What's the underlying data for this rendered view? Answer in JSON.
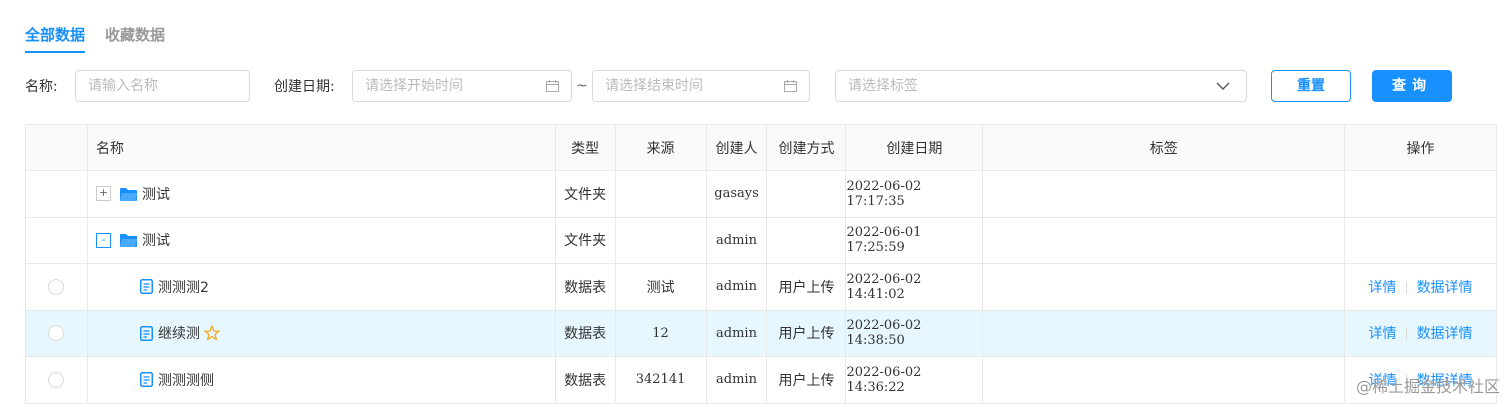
{
  "tabs": [
    {
      "label": "全部数据",
      "active": true
    },
    {
      "label": "收藏数据",
      "active": false
    }
  ],
  "filters": {
    "name_label": "名称:",
    "name_placeholder": "请输入名称",
    "date_label": "创建日期:",
    "start_placeholder": "请选择开始时间",
    "end_placeholder": "请选择结束时间",
    "range_separator": "~",
    "tag_placeholder": "请选择标签",
    "reset_label": "重置",
    "query_label": "查询"
  },
  "table": {
    "headers": [
      "名称",
      "类型",
      "来源",
      "创建人",
      "创建方式",
      "创建日期",
      "标签",
      "操作"
    ],
    "rows": [
      {
        "kind": "folder",
        "expander": "+",
        "name": "测试",
        "type": "文件夹",
        "source": "",
        "creator": "gasays",
        "method": "",
        "date": "2022-06-02 17:17:35",
        "tag": ""
      },
      {
        "kind": "folder",
        "expander": "-",
        "name": "测试",
        "type": "文件夹",
        "source": "",
        "creator": "admin",
        "method": "",
        "date": "2022-06-01 17:25:59",
        "tag": ""
      },
      {
        "kind": "file",
        "name": "测测测2",
        "type": "数据表",
        "source": "测试",
        "creator": "admin",
        "method": "用户上传",
        "date": "2022-06-02 14:41:02",
        "tag": "",
        "actions": [
          "详情",
          "数据详情"
        ]
      },
      {
        "kind": "file",
        "name": "继续测",
        "starred": true,
        "type": "数据表",
        "source": "12",
        "creator": "admin",
        "method": "用户上传",
        "date": "2022-06-02 14:38:50",
        "tag": "",
        "actions": [
          "详情",
          "数据详情"
        ],
        "highlight": true
      },
      {
        "kind": "file",
        "name": "测测测侧",
        "type": "数据表",
        "source": "342141",
        "creator": "admin",
        "method": "用户上传",
        "date": "2022-06-02 14:36:22",
        "tag": "",
        "actions": [
          "详情",
          "数据详情"
        ]
      }
    ]
  },
  "watermark": "@稀土掘金技术社区",
  "colors": {
    "accent": "#1890ff",
    "row_highlight": "#e6f7ff",
    "star": "#f5a623"
  }
}
